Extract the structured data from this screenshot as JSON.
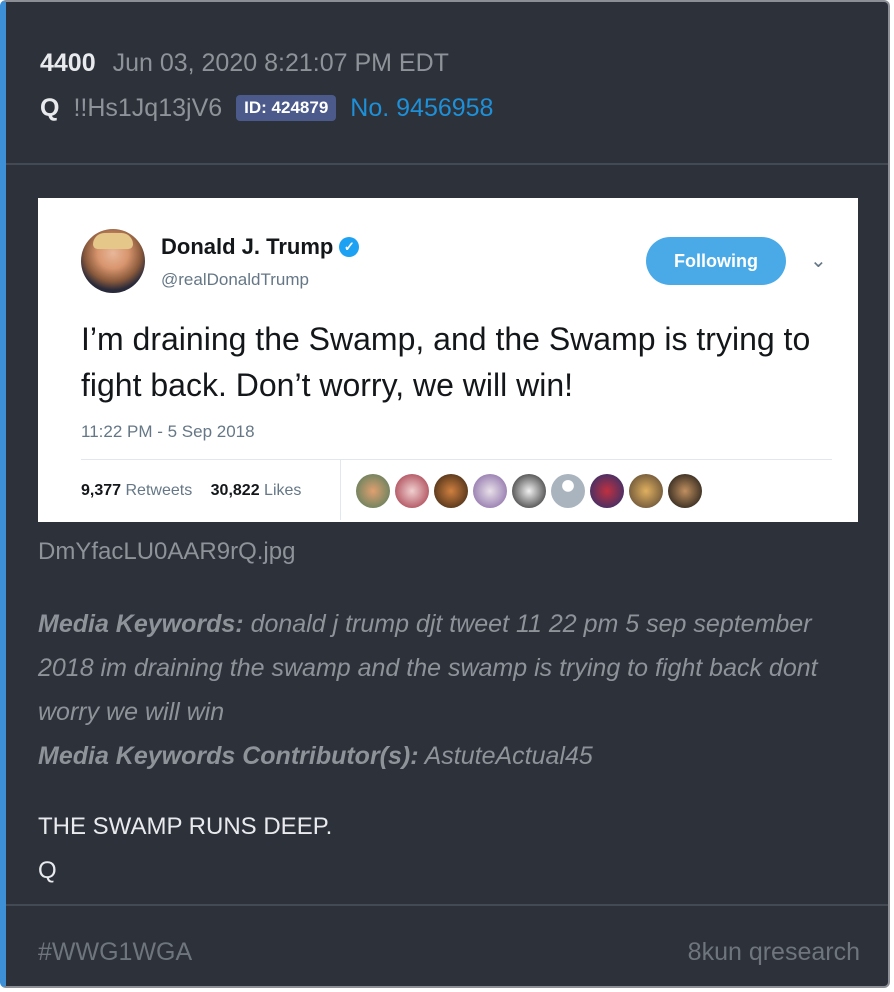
{
  "post": {
    "number": "4400",
    "date": "Jun 03, 2020 8:21:07 PM EDT",
    "author": "Q",
    "tripcode": "!!Hs1Jq13jV6",
    "id_badge": "ID: 424879",
    "post_no": "No. 9456958"
  },
  "tweet": {
    "name": "Donald J. Trump",
    "handle": "@realDonaldTrump",
    "follow_label": "Following",
    "text": "I’m draining the Swamp, and the Swamp is trying to fight back. Don’t worry, we will win!",
    "time": "11:22 PM - 5 Sep 2018",
    "retweets_count": "9,377",
    "retweets_label": "Retweets",
    "likes_count": "30,822",
    "likes_label": "Likes",
    "verified_icon": "verified-badge-icon",
    "chevron_icon": "chevron-down-icon"
  },
  "attachment": {
    "filename": "DmYfacLU0AAR9rQ.jpg"
  },
  "keywords": {
    "label": "Media Keywords:",
    "text": "donald j trump djt tweet 11 22 pm 5 sep september 2018 im draining the swamp and the swamp is trying to fight back dont worry we will win",
    "contributor_label": "Media Keywords Contributor(s):",
    "contributor": "AstuteActual45"
  },
  "message": {
    "line1": "THE SWAMP RUNS DEEP.",
    "line2": "Q"
  },
  "footer": {
    "tag": "#WWG1WGA",
    "source": "8kun qresearch"
  },
  "colors": {
    "background": "#2c313a",
    "accent": "#3d8fd6",
    "link": "#1e90d8",
    "badge": "#4b5a8a",
    "twitter_blue": "#1da1f2"
  }
}
